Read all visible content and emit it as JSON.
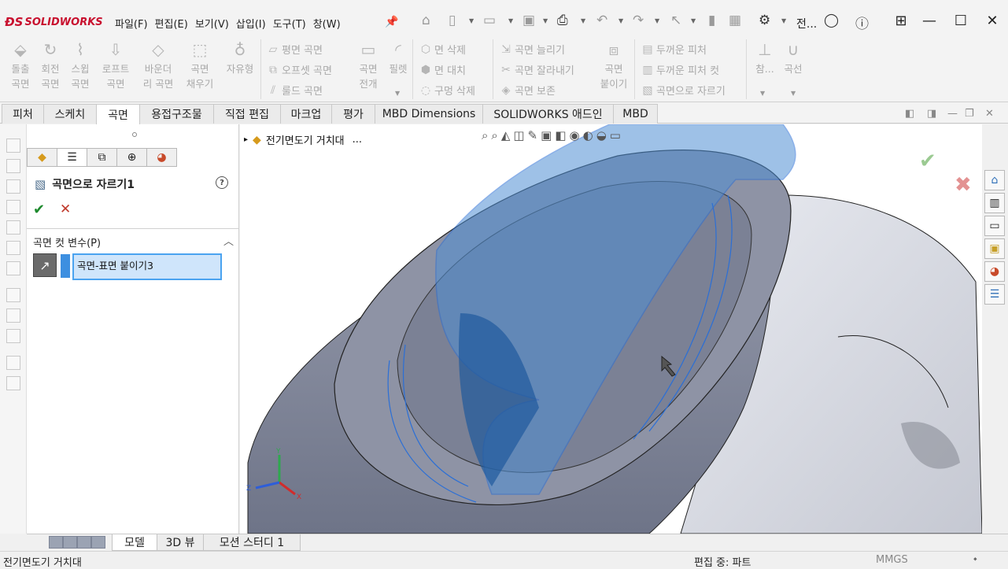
{
  "app": {
    "logo_ds": "ƉS",
    "logo_text": "SOLIDWORKS"
  },
  "menu": [
    "파일(F)",
    "편집(E)",
    "보기(V)",
    "삽입(I)",
    "도구(T)",
    "창(W)"
  ],
  "quick_access": {
    "title_short": "전..."
  },
  "ribbon": {
    "big_left": [
      {
        "l1": "돌출",
        "l2": "곡면",
        "icon": "extrude-surface-icon"
      },
      {
        "l1": "회전",
        "l2": "곡면",
        "icon": "revolve-surface-icon"
      },
      {
        "l1": "스윕",
        "l2": "곡면",
        "icon": "sweep-surface-icon"
      },
      {
        "l1": "로프트",
        "l2": "곡면",
        "icon": "loft-surface-icon"
      },
      {
        "l1": "바운더",
        "l2": "리 곡면",
        "icon": "boundary-surface-icon"
      },
      {
        "l1": "곡면",
        "l2": "채우기",
        "icon": "fill-surface-icon"
      },
      {
        "l1": "자유형",
        "l2": "",
        "icon": "freeform-icon"
      }
    ],
    "col1": [
      "평면 곡면",
      "오프셋 곡면",
      "룰드 곡면"
    ],
    "big_mid1": {
      "l1": "곡면",
      "l2": "전개"
    },
    "big_mid2": {
      "l1": "필렛",
      "l2": ""
    },
    "col2": [
      "면 삭제",
      "면 대치",
      "구멍 삭제"
    ],
    "col3": [
      "곡면 늘리기",
      "곡면 잘라내기",
      "곡면 보존"
    ],
    "big_mid3": {
      "l1": "곡면",
      "l2": "붙이기"
    },
    "col4": [
      "두꺼운 피처",
      "두꺼운 피처 컷",
      "곡면으로 자르기"
    ],
    "big_right1": {
      "l1": "참...",
      "l2": ""
    },
    "big_right2": {
      "l1": "곡선",
      "l2": ""
    }
  },
  "tabs": [
    {
      "label": "피처",
      "active": false
    },
    {
      "label": "스케치",
      "active": false
    },
    {
      "label": "곡면",
      "active": true
    },
    {
      "label": "용접구조물",
      "active": false
    },
    {
      "label": "직접 편집",
      "active": false
    },
    {
      "label": "마크업",
      "active": false
    },
    {
      "label": "평가",
      "active": false
    },
    {
      "label": "MBD Dimensions",
      "active": false
    },
    {
      "label": "SOLIDWORKS 애드인",
      "active": false
    },
    {
      "label": "MBD",
      "active": false
    }
  ],
  "property_manager": {
    "title": "곡면으로 자르기1",
    "help": "?",
    "section_title": "곡면 컷 변수(P)",
    "selection_value": "곡면-표면 붙이기3"
  },
  "viewport": {
    "tree_root": "전기면도기 거치대",
    "tree_ellipsis": "...",
    "model_colors": {
      "body": "#8f95a7",
      "surface": "#4f8fd4",
      "background": "#ffffff"
    },
    "triad": {
      "x": "X",
      "y": "Y",
      "z": "Z"
    }
  },
  "bottom_tabs": [
    {
      "label": "모델",
      "active": true
    },
    {
      "label": "3D 뷰",
      "active": false
    },
    {
      "label": "모션 스터디 1",
      "active": false
    }
  ],
  "status": {
    "left": "전기면도기 거치대",
    "mode": "편집 중: 파트",
    "units": "MMGS"
  }
}
